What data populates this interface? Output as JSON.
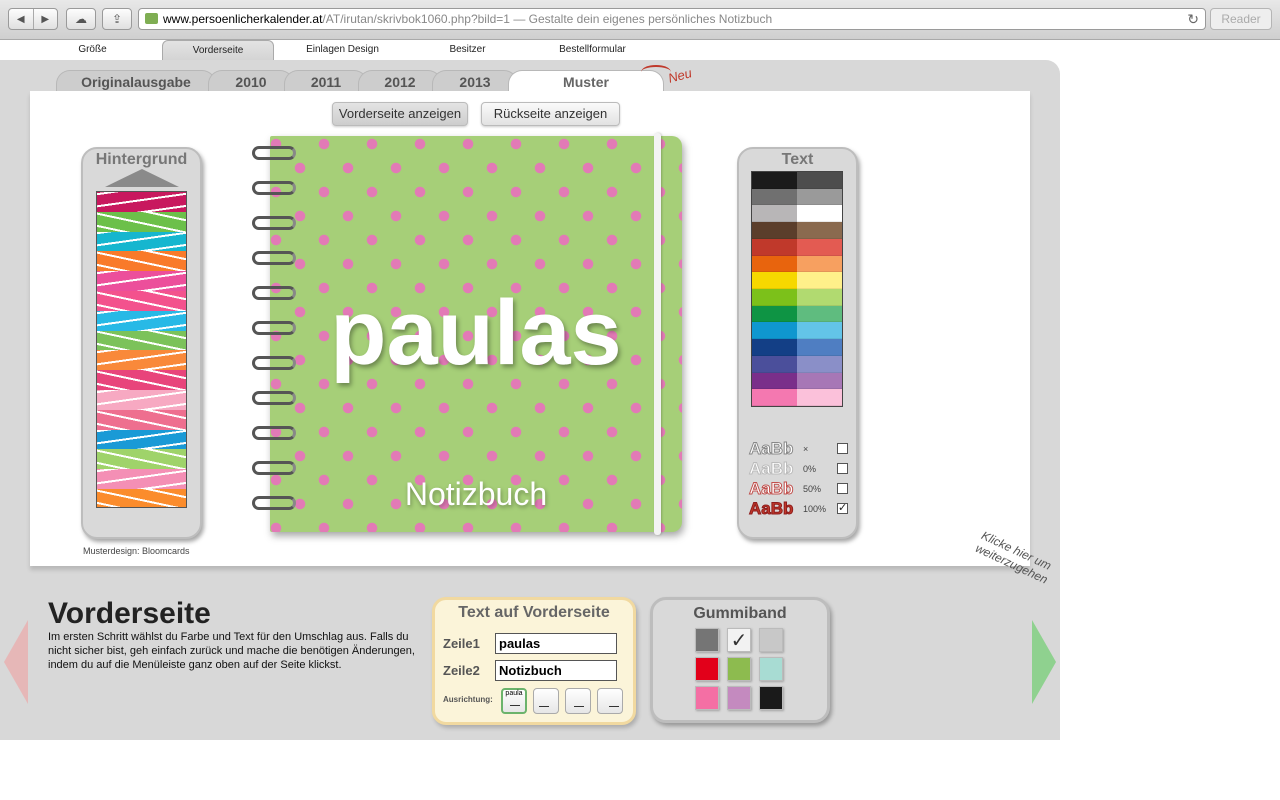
{
  "browser": {
    "url_host": "www.persoenlicherkalender.at",
    "url_path": "/AT/irutan/skrivbok1060.php?bild=1",
    "title": " — Gestalte dein eigenes persönliches Notizbuch",
    "reader_label": "Reader"
  },
  "topnav": [
    "Größe",
    "Vorderseite",
    "Einlagen Design",
    "Besitzer",
    "Bestellformular"
  ],
  "year_tabs": [
    "Originalausgabe",
    "2010",
    "2011",
    "2012",
    "2013",
    "Muster"
  ],
  "new_badge": "Neu",
  "view_buttons": {
    "front": "Vorderseite anzeigen",
    "back": "Rückseite anzeigen"
  },
  "background_panel": {
    "title": "Hintergrund",
    "swatches": [
      "#c8185e",
      "#6cc04a",
      "#16b6cf",
      "#f97a2a",
      "#ec4f9b",
      "#f3528d",
      "#28b9e6",
      "#7cc25a",
      "#f9893a",
      "#e8447b",
      "#f7a9c2",
      "#ee6f8f",
      "#1a9ad6",
      "#9fd36a",
      "#f48fb5",
      "#fb8c2c"
    ]
  },
  "text_panel": {
    "title": "Text",
    "colors": [
      [
        "#1b1b1b",
        "#4d4d4d"
      ],
      [
        "#707070",
        "#9a9a9a"
      ],
      [
        "#b8b6b7",
        "#ffffff"
      ],
      [
        "#5b3e2b",
        "#8a6a4f"
      ],
      [
        "#c0392b",
        "#e35b52"
      ],
      [
        "#e8640d",
        "#f7a060"
      ],
      [
        "#f6d800",
        "#fff08a"
      ],
      [
        "#7cc11a",
        "#b1da70"
      ],
      [
        "#0e9444",
        "#5fbc7f"
      ],
      [
        "#0f97cf",
        "#63c4e8"
      ],
      [
        "#133f86",
        "#4f7ec2"
      ],
      [
        "#4b4f9b",
        "#8a8fc8"
      ],
      [
        "#7a2f8a",
        "#a777b6"
      ],
      [
        "#f478b0",
        "#fbc1da"
      ]
    ],
    "styles": [
      {
        "sample": "AaBb",
        "label": "×",
        "checked": false
      },
      {
        "sample": "AaBb",
        "label": "0%",
        "checked": false
      },
      {
        "sample": "AaBb",
        "label": "50%",
        "checked": false
      },
      {
        "sample": "AaBb",
        "label": "100%",
        "checked": true
      }
    ]
  },
  "notebook": {
    "title": "paulas",
    "subtitle": "Notizbuch",
    "cover_color": "#a6cf78",
    "dot_color": "#e27ab6"
  },
  "credit": "Musterdesign: Bloomcards",
  "bottom": {
    "title": "Vorderseite",
    "text": "Im ersten Schritt wählst du Farbe und Text für den Umschlag aus. Falls du nicht sicher bist, geh einfach zurück und mache die benötigen Änderungen, indem du auf die Menüleiste ganz oben auf der Seite klickst.",
    "hint": "Klicke hier um weiterzugehen"
  },
  "text_front": {
    "title": "Text auf Vorderseite",
    "zeile1_label": "Zeile1",
    "zeile1_value": "paulas",
    "zeile2_label": "Zeile2",
    "zeile2_value": "Notizbuch",
    "align_label": "Ausrichtung:",
    "align_sample": "paula"
  },
  "gummiband": {
    "title": "Gummiband",
    "colors": [
      "#757575",
      "#f2f2f2",
      "#c8c8c8",
      "#e2001a",
      "#8dbb4f",
      "#a8dcd3",
      "#f46fa4",
      "#c48abf",
      "#1a1a1a"
    ],
    "selected_index": 1
  }
}
